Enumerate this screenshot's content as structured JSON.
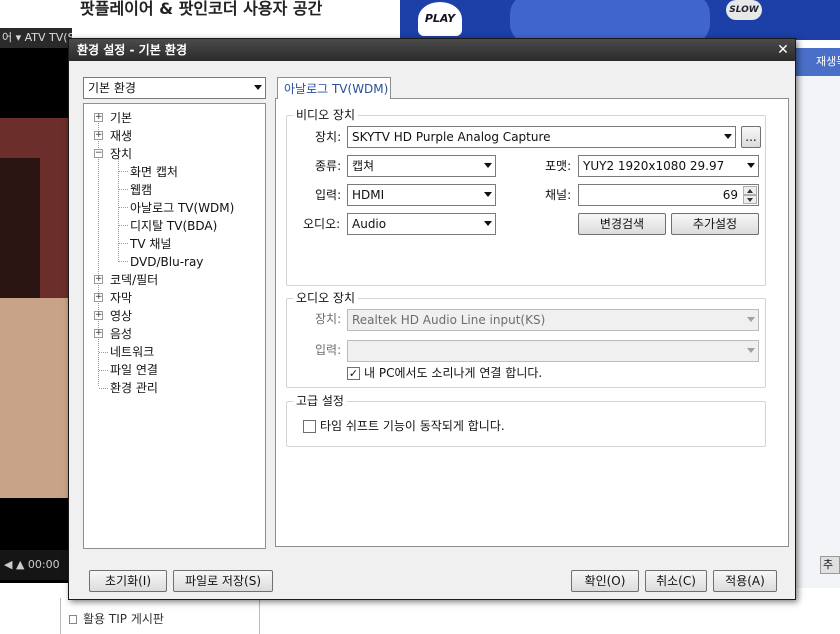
{
  "background": {
    "heading": "팟플레이어 & 팟인코더 사용자 공간",
    "banner_play": "PLAY",
    "banner_slow": "SLOW",
    "player_bar": "어 ▾   ATV  TV(SKY)HD",
    "player_time": "◀ ▲  00:00",
    "right_header": "재생목",
    "right_button": "추",
    "list_items": [
      "활용 TIP 게시판"
    ]
  },
  "dialog": {
    "title": "환경 설정 - 기본 환경",
    "close": "✕",
    "profile_combo": "기본 환경",
    "tree": [
      {
        "label": "기본",
        "expander": "+"
      },
      {
        "label": "재생",
        "expander": "+"
      },
      {
        "label": "장치",
        "expander": "−"
      },
      {
        "label": "화면 캡처"
      },
      {
        "label": "웹캠"
      },
      {
        "label": "아날로그 TV(WDM)",
        "selected": true
      },
      {
        "label": "디지탈 TV(BDA)"
      },
      {
        "label": "TV 채널"
      },
      {
        "label": "DVD/Blu-ray"
      },
      {
        "label": "코덱/필터",
        "expander": "+"
      },
      {
        "label": "자막",
        "expander": "+"
      },
      {
        "label": "영상",
        "expander": "+"
      },
      {
        "label": "음성",
        "expander": "+"
      },
      {
        "label": "네트워크"
      },
      {
        "label": "파일 연결"
      },
      {
        "label": "환경 관리"
      }
    ],
    "tab_label": "아날로그 TV(WDM)",
    "video": {
      "group_label": "비디오 장치",
      "device_label": "장치:",
      "device_value": "SKYTV HD Purple Analog Capture",
      "browse": "...",
      "type_label": "종류:",
      "type_value": "캡쳐",
      "format_label": "포맷:",
      "format_value": "YUY2 1920x1080 29.97",
      "input_label": "입력:",
      "input_value": "HDMI",
      "channel_label": "채널:",
      "channel_value": "69",
      "audio_label": "오디오:",
      "audio_value": "Audio",
      "scan_button": "변경검색",
      "extra_button": "추가설정"
    },
    "audio": {
      "group_label": "오디오 장치",
      "device_label": "장치:",
      "device_value": "Realtek HD Audio Line input(KS)",
      "input_label": "입력:",
      "input_value": "",
      "connect_check": "✓",
      "connect_label": "내 PC에서도 소리나게 연결 합니다."
    },
    "advanced": {
      "group_label": "고급 설정",
      "timeshift_label": "타임 쉬프트 기능이 동작되게 합니다."
    },
    "buttons": {
      "reset": "초기화(I)",
      "save_file": "파일로 저장(S)",
      "ok": "확인(O)",
      "cancel": "취소(C)",
      "apply": "적용(A)"
    }
  }
}
